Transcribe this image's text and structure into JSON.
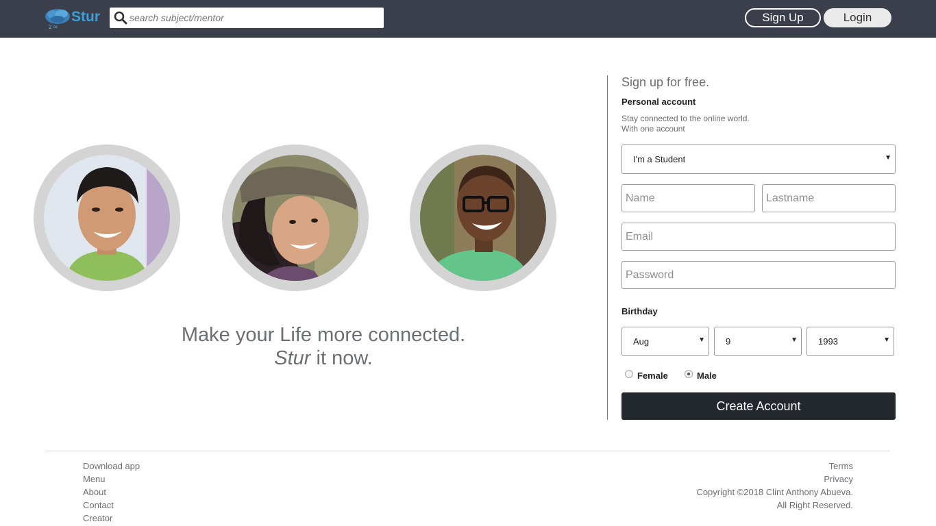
{
  "header": {
    "logo_text": "Stur",
    "search_placeholder": "search subject/mentor",
    "signup_label": "Sign Up",
    "login_label": "Login",
    "colors": {
      "bar": "#3a3f4b",
      "logo": "#3ba0d8"
    }
  },
  "hero": {
    "line1": "Make your Life more connected.",
    "line2_brand": "Stur",
    "line2_rest": " it now.",
    "avatars": [
      "person-1",
      "person-2",
      "person-3"
    ]
  },
  "form": {
    "title": "Sign up for free.",
    "subtitle": "Personal account",
    "desc_line1": "Stay connected to the online world.",
    "desc_line2": "With one account",
    "role_selected": "I'm a Student",
    "name_placeholder": "Name",
    "lastname_placeholder": "Lastname",
    "email_placeholder": "Email",
    "password_placeholder": "Password",
    "birthday_label": "Birthday",
    "month": "Aug",
    "day": "9",
    "year": "1993",
    "gender_female": "Female",
    "gender_male": "Male",
    "gender_selected": "Male",
    "create_label": "Create Account",
    "colors": {
      "button": "#23272e"
    }
  },
  "footer": {
    "left_links": [
      "Download app",
      "Menu",
      "About",
      "Contact",
      "Creator"
    ],
    "terms": "Terms",
    "privacy": "Privacy",
    "copyright": "Copyright ©2018 Clint Anthony Abueva.",
    "rights": "All Right Reserved."
  }
}
